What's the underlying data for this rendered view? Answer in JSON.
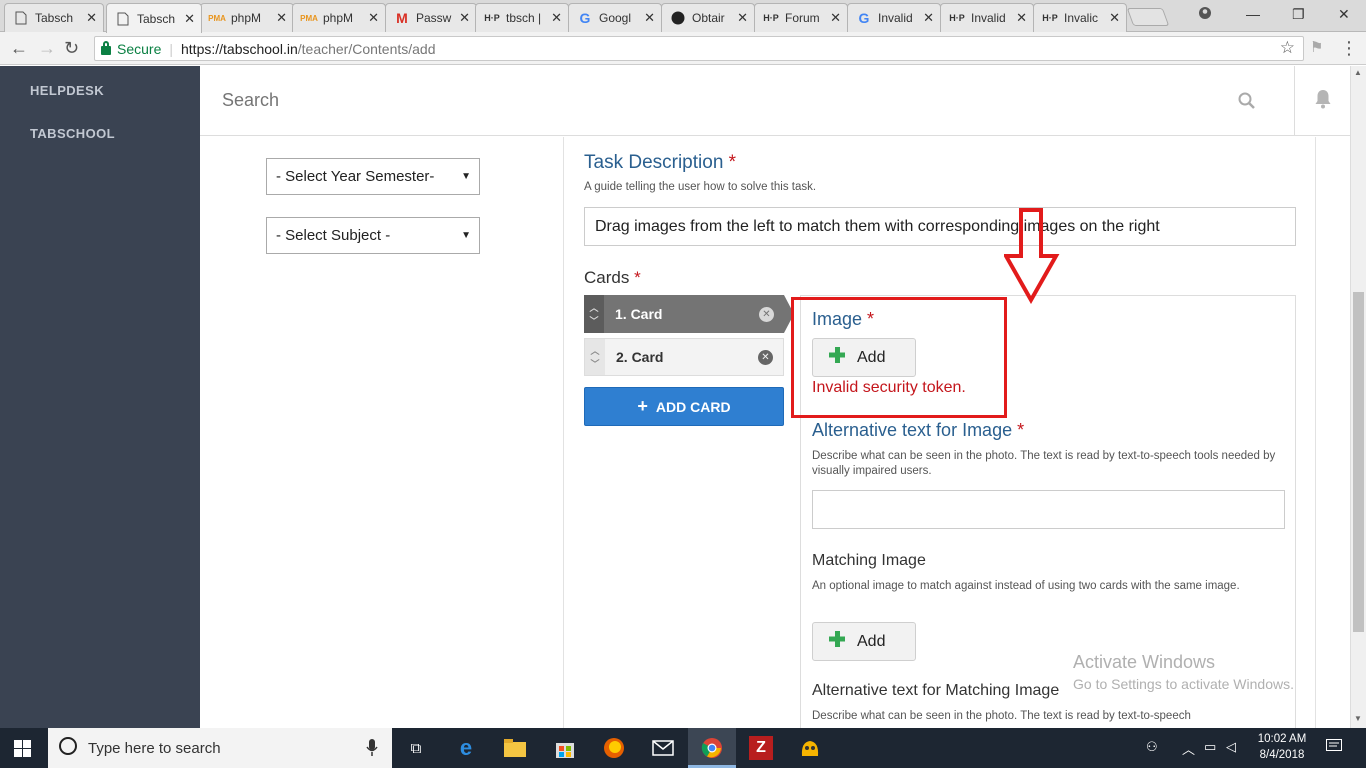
{
  "browser": {
    "tabs": [
      {
        "label": "Tabsch",
        "icon": "page-icon"
      },
      {
        "label": "Tabsch",
        "icon": "page-icon",
        "active": true
      },
      {
        "label": "phpM",
        "icon": "pma-icon"
      },
      {
        "label": "phpM",
        "icon": "pma-icon"
      },
      {
        "label": "Passw",
        "icon": "gmail-icon"
      },
      {
        "label": "tbsch |",
        "icon": "hp-icon"
      },
      {
        "label": "Googl",
        "icon": "google-icon"
      },
      {
        "label": "Obtair",
        "icon": "github-icon"
      },
      {
        "label": "Forum",
        "icon": "hp-icon"
      },
      {
        "label": "Invalid",
        "icon": "google-icon"
      },
      {
        "label": "Invalid",
        "icon": "hp-icon"
      },
      {
        "label": "Invalic",
        "icon": "hp-icon"
      }
    ],
    "secure_label": "Secure",
    "url_host": "https://tabschool.in",
    "url_path": "/teacher/Contents/add"
  },
  "sidebar": {
    "items": [
      {
        "label": "HELPDESK"
      },
      {
        "label": "TABSCHOOL"
      }
    ]
  },
  "topbar": {
    "search_placeholder": "Search"
  },
  "filters": {
    "year_semester": "- Select Year Semester-",
    "subject": "- Select Subject -"
  },
  "task": {
    "title": "Task Description",
    "required_mark": "*",
    "description": "A guide telling the user how to solve this task.",
    "value": "Drag images from the left to match them with corresponding images on the right"
  },
  "cards": {
    "title": "Cards",
    "items": [
      {
        "label": "1. Card"
      },
      {
        "label": "2. Card"
      }
    ],
    "add_label": "ADD CARD"
  },
  "card_form": {
    "image_title": "Image",
    "add_label": "Add",
    "error": "Invalid security token.",
    "alt_title": "Alternative text for Image",
    "alt_desc": "Describe what can be seen in the photo. The text is read by text-to-speech tools needed by visually impaired users.",
    "matching_title": "Matching Image",
    "matching_desc": "An optional image to match against instead of using two cards with the same image.",
    "matching_add_label": "Add",
    "matching_alt_title": "Alternative text for Matching Image",
    "matching_alt_desc": "Describe what can be seen in the photo. The text is read by text-to-speech"
  },
  "watermark": {
    "line1": "Activate Windows",
    "line2": "Go to Settings to activate Windows."
  },
  "taskbar": {
    "search_placeholder": "Type here to search",
    "time": "10:02 AM",
    "date": "8/4/2018"
  },
  "colors": {
    "sidebar_bg": "#3a4352",
    "accent_blue": "#2f7fd1",
    "title_blue": "#2a5f8f",
    "required_red": "#c4161c",
    "annotation_red": "#e21b1b"
  }
}
